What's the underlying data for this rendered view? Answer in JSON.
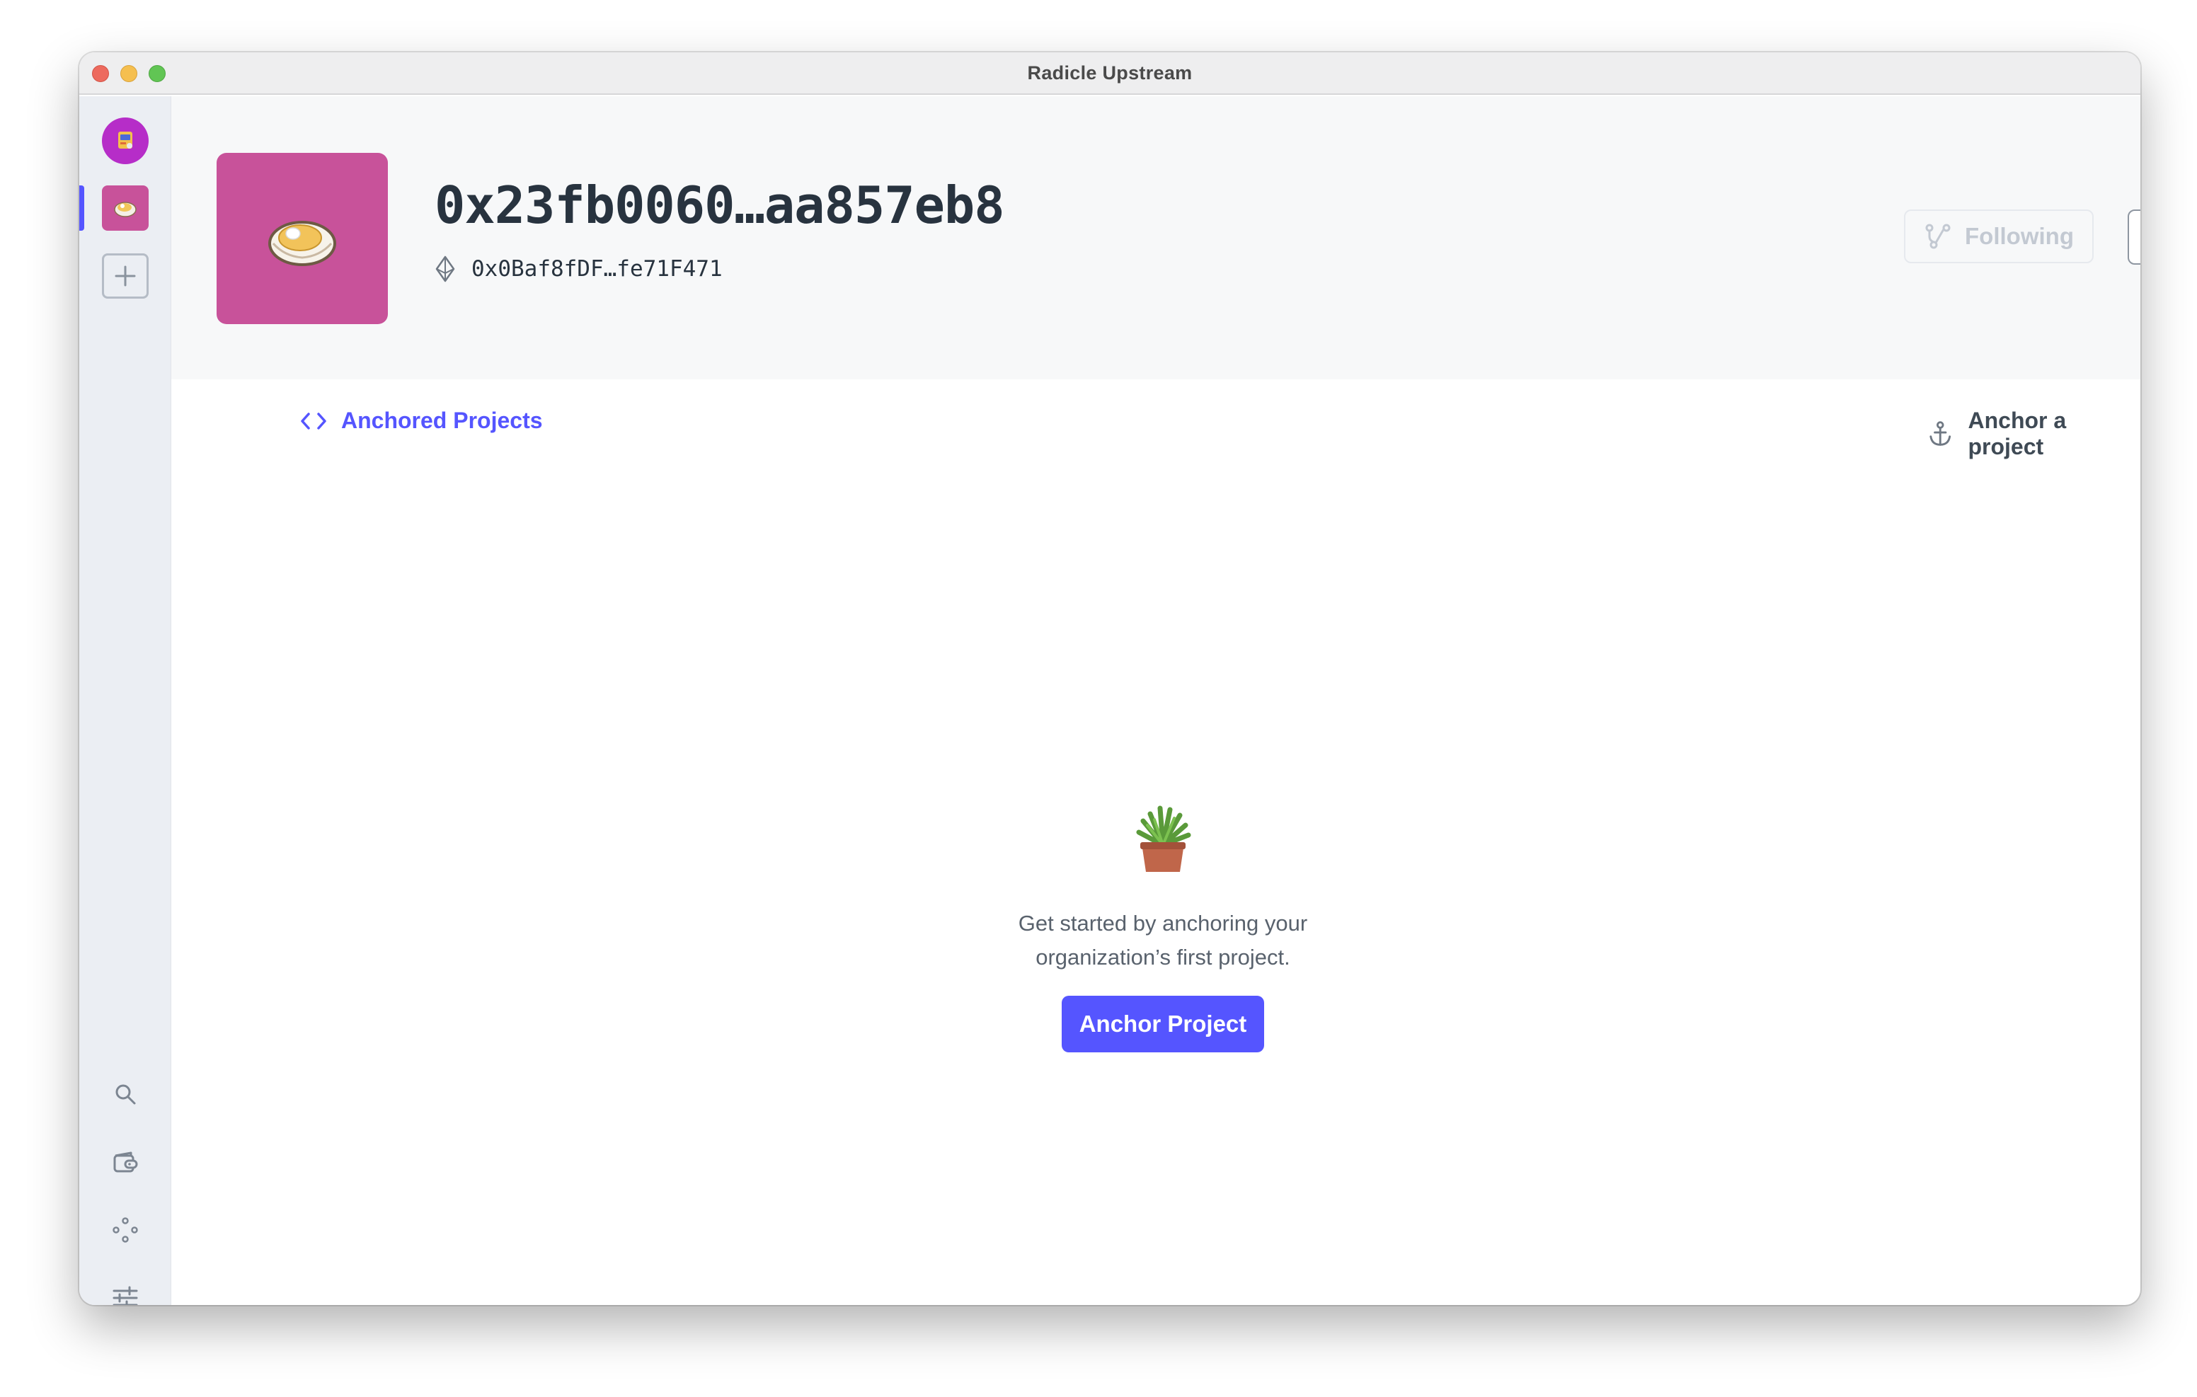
{
  "window": {
    "title": "Radicle Upstream"
  },
  "sidebar": {
    "items": [
      {
        "name": "user-avatar",
        "icon": "avatar-icon"
      },
      {
        "name": "org-oyster",
        "icon": "oyster-icon",
        "active": true
      },
      {
        "name": "add-org",
        "icon": "plus-icon"
      }
    ],
    "bottom_icons": [
      "search-icon",
      "wallet-icon",
      "network-icon",
      "settings-icon"
    ]
  },
  "org": {
    "name": "0x23fb0060…aa857eb8",
    "address": "0x0Baf8fDF…fe71F471",
    "avatar_color": "#c8529a"
  },
  "actions": {
    "following_label": "Following",
    "more_icon": "ellipsis-icon"
  },
  "tabs": {
    "anchored_label": "Anchored Projects"
  },
  "anchor_link": {
    "label": "Anchor a project"
  },
  "empty_state": {
    "line1": "Get started by anchoring your",
    "line2": "organization’s first project.",
    "button_label": "Anchor Project"
  },
  "colors": {
    "accent": "#5555ff",
    "sidebar_bg": "#ebeef3",
    "header_bg": "#f7f8f9"
  }
}
